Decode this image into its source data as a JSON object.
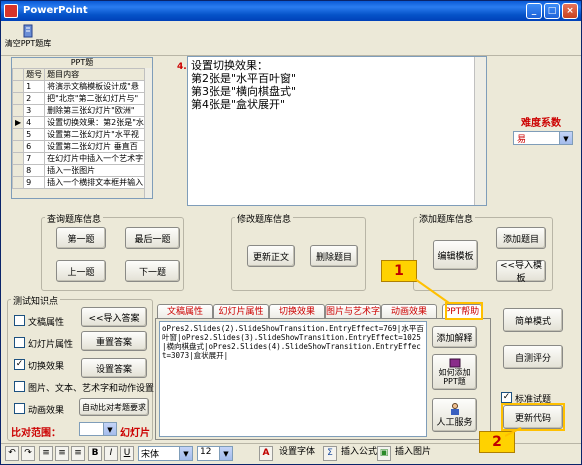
{
  "window": {
    "title": "PowerPoint",
    "min": "_",
    "max": "□",
    "close": "×"
  },
  "toolbar": {
    "clear_label": "清空PPT题库"
  },
  "question_table": {
    "caption": "PPT题",
    "headers": [
      "题号",
      "题目内容"
    ],
    "current_row": 4,
    "rows": [
      {
        "num": "1",
        "text": "将演示文稿模板设计成\"悬"
      },
      {
        "num": "2",
        "text": "把\"北京\"第二张幻灯片与\""
      },
      {
        "num": "3",
        "text": "删除第三张幻灯片\"欧洲\""
      },
      {
        "num": "4",
        "text": "设置切换效果：第2张是\"水"
      },
      {
        "num": "5",
        "text": "设置第二张幻灯片\"水平视"
      },
      {
        "num": "6",
        "text": "设置第二张幻灯片 垂直百"
      },
      {
        "num": "7",
        "text": "在幻灯片中插入一个艺术字"
      },
      {
        "num": "8",
        "text": "插入一张图片"
      },
      {
        "num": "9",
        "text": "插入一个横排文本框并输入"
      }
    ]
  },
  "question_text": {
    "number": "4.",
    "lines": [
      "设置切换效果：",
      "第2张是\"水平百叶窗\"",
      "第3张是\"横向棋盘式\"",
      "第4张是\"盒状展开\""
    ]
  },
  "difficulty": {
    "label": "难度系数",
    "value": "易"
  },
  "query_group": {
    "label": "查询题库信息",
    "first": "第一题",
    "last": "最后一题",
    "prev": "上一题",
    "next": "下一题"
  },
  "modify_group": {
    "label": "修改题库信息",
    "update": "更新正文",
    "delete": "删除题目"
  },
  "add_group": {
    "label": "添加题库信息",
    "edit_template": "编辑模板",
    "add": "添加题目",
    "import": "<<导入模板"
  },
  "test_group": {
    "label": "测试知识点",
    "checks": [
      {
        "label": "文稿属性",
        "checked": false
      },
      {
        "label": "幻灯片属性",
        "checked": false
      },
      {
        "label": "切换效果",
        "checked": true
      },
      {
        "label": "图片、文本、艺术字和动作设置",
        "checked": false
      },
      {
        "label": "动画效果",
        "checked": false
      }
    ],
    "import_answer": "<<导入答案",
    "reset_answer": "重置答案",
    "set_answer": "设置答案",
    "auto_compare": "自动比对考题要求",
    "range_label": "比对范围：",
    "slide_label": "幻灯片"
  },
  "tabs": [
    "文稿属性",
    "幻灯片属性",
    "切换效果",
    "图片与艺术字",
    "动画效果",
    "PPT帮助"
  ],
  "code_text": "oPres2.Slides(2).SlideShowTransition.EntryEffect=769|水平百叶窗|oPres2.Slides(3).SlideShowTransition.EntryEffect=1025|横向棋盘式|oPres2.Slides(4).SlideShowTransition.EntryEffect=3073|盒状展开|",
  "side_buttons": {
    "add_explain": "添加解释",
    "how_add_line1": "如何添加",
    "how_add_line2": "PPT题",
    "manual": "人工服务"
  },
  "right_buttons": {
    "simple_mode": "简单模式",
    "self_score": "自测评分",
    "standard_check": "标准试题",
    "standard_checked": true,
    "update_code": "更新代码"
  },
  "format_bar": {
    "font": "宋体",
    "size": "12",
    "bold": "B",
    "italic": "I",
    "underline": "U",
    "set_font": "设置字体",
    "insert_formula": "插入公式",
    "insert_image": "插入图片"
  },
  "annotations": {
    "badge1": "1",
    "badge2": "2"
  },
  "colors": {
    "titlebar": "#0a5ad6",
    "face": "#ece9d8",
    "accent": "#cc0000",
    "highlight": "#ffc000"
  }
}
